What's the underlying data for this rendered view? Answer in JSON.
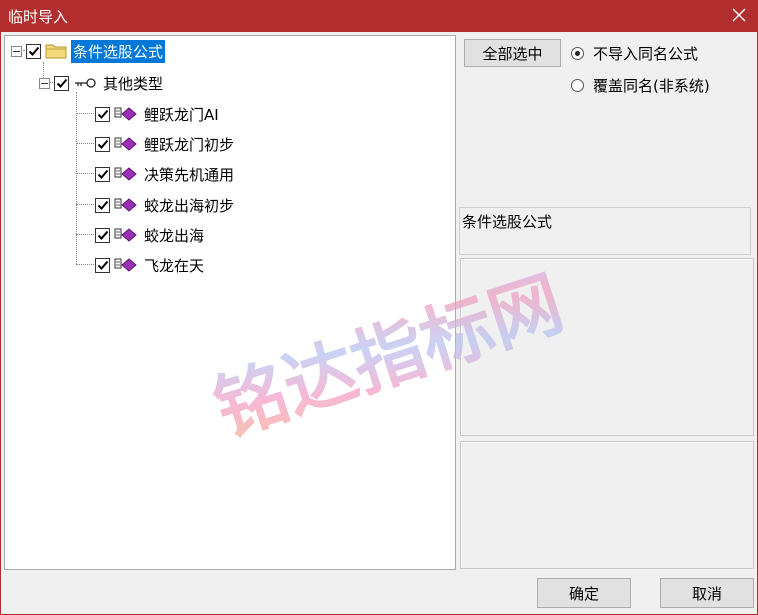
{
  "window": {
    "title": "临时导入"
  },
  "tree": {
    "root": {
      "label": "条件选股公式",
      "checked": true
    },
    "group": {
      "label": "其他类型",
      "checked": true
    },
    "items": [
      {
        "label": "鲤跃龙门AI",
        "checked": true
      },
      {
        "label": "鲤跃龙门初步",
        "checked": true
      },
      {
        "label": "决策先机通用",
        "checked": true
      },
      {
        "label": "蛟龙出海初步",
        "checked": true
      },
      {
        "label": "蛟龙出海",
        "checked": true
      },
      {
        "label": "飞龙在天",
        "checked": true
      }
    ]
  },
  "options": {
    "select_all_label": "全部选中",
    "radio_no_import": "不导入同名公式",
    "radio_overwrite": "覆盖同名(非系统)",
    "selected": "no_import"
  },
  "info": {
    "category_label": "条件选股公式"
  },
  "buttons": {
    "ok": "确定",
    "cancel": "取消"
  },
  "watermark": {
    "text": "铭达指标网"
  },
  "colors": {
    "titlebar": "#b22d2d",
    "selection": "#0078d7",
    "item_icon": "#9b2fb5"
  }
}
